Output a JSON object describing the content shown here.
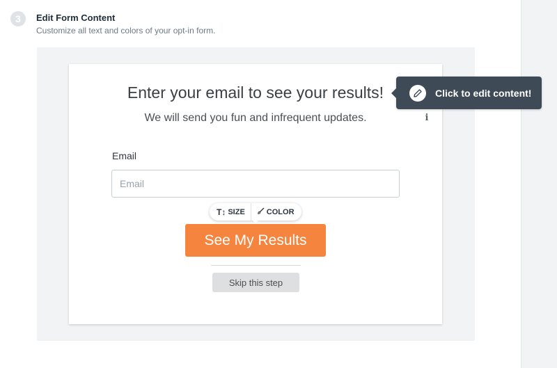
{
  "step": {
    "number": "3",
    "title": "Edit Form Content",
    "subtitle": "Customize all text and colors of your opt-in form."
  },
  "form": {
    "headline": "Enter your email to see your results!",
    "subheadline": "We will send you fun and infrequent updates.",
    "info_icon": "info-icon",
    "email_label": "Email",
    "email_placeholder": "Email",
    "email_value": "",
    "submit_label": "See My Results",
    "skip_label": "Skip this step"
  },
  "style_toolbar": {
    "size_label": "SIZE",
    "color_label": "COLOR",
    "size_icon": "text-size-icon",
    "color_icon": "brush-icon"
  },
  "tooltip": {
    "text": "Click to edit content!",
    "icon": "pencil-icon"
  },
  "colors": {
    "accent_button": "#f5843f",
    "tooltip_bg": "#3e4b57",
    "preview_bg": "#f1f3f4"
  }
}
